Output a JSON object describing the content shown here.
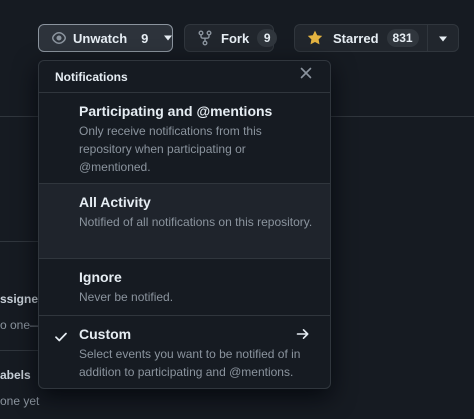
{
  "buttons": {
    "unwatch": {
      "label": "Unwatch",
      "count": "9"
    },
    "fork": {
      "label": "Fork",
      "count": "9"
    },
    "starred": {
      "label": "Starred",
      "count": "831"
    }
  },
  "background": {
    "assignees_label": "ssigne",
    "assignees_value": "o one—",
    "labels_label": "abels",
    "labels_value": " one yet"
  },
  "notifications": {
    "title": "Notifications",
    "items": [
      {
        "title": "Participating and @mentions",
        "desc": "Only receive notifications from this repository when participating or @mentioned.",
        "selected": false
      },
      {
        "title": "All Activity",
        "desc": "Notified of all notifications on this repository.",
        "selected": false
      },
      {
        "title": "Ignore",
        "desc": "Never be notified.",
        "selected": false
      },
      {
        "title": "Custom",
        "desc": "Select events you want to be notified of in addition to participating and @mentions.",
        "selected": true
      }
    ]
  },
  "icons": {
    "eye": "eye-icon",
    "fork": "repo-forked-icon",
    "star": "star-fill-icon",
    "caret": "triangle-down-icon",
    "close": "x-icon",
    "check": "check-icon",
    "arrow": "arrow-right-icon"
  },
  "colors": {
    "star": "#e3b341",
    "accent_border": "#8b949e"
  }
}
